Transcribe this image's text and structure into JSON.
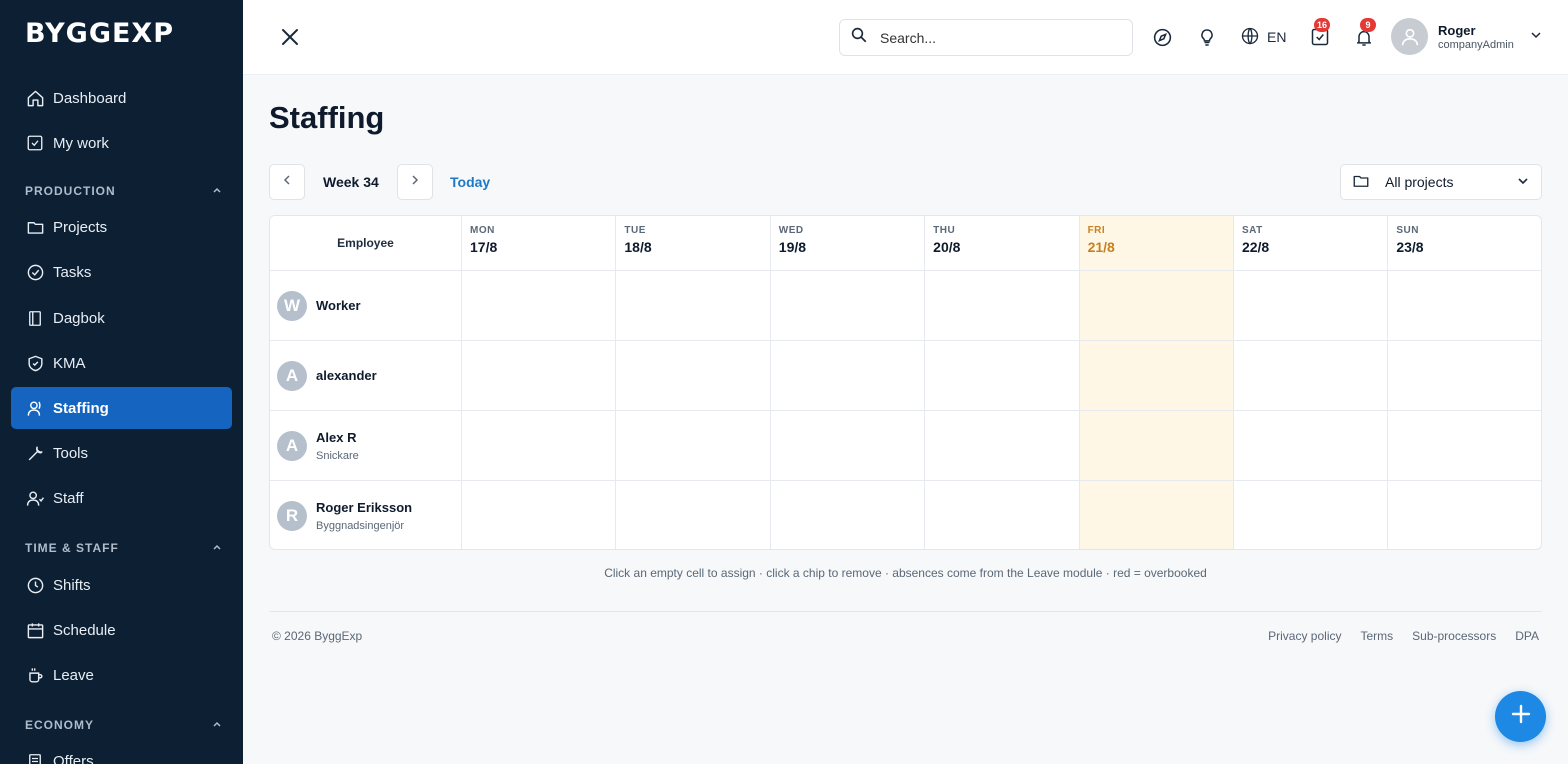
{
  "brand": {
    "logo": "BYGGEXP"
  },
  "sidebar": {
    "items": [
      {
        "label": "Dashboard",
        "icon": "home-icon"
      },
      {
        "label": "My work",
        "icon": "checkbox-icon"
      },
      {
        "label": "Projects",
        "icon": "folder-icon"
      },
      {
        "label": "Tasks",
        "icon": "check-circle-icon"
      },
      {
        "label": "Dagbok",
        "icon": "book-icon"
      },
      {
        "label": "KMA",
        "icon": "shield-icon"
      },
      {
        "label": "Staffing",
        "icon": "users-icon",
        "active": true
      },
      {
        "label": "Tools",
        "icon": "wrench-icon"
      },
      {
        "label": "Staff",
        "icon": "user-group-icon"
      },
      {
        "label": "Shifts",
        "icon": "clock-icon"
      },
      {
        "label": "Schedule",
        "icon": "calendar-icon"
      },
      {
        "label": "Leave",
        "icon": "coffee-icon"
      },
      {
        "label": "Offers",
        "icon": "document-icon"
      }
    ],
    "sections": [
      "PRODUCTION",
      "TIME & STAFF",
      "ECONOMY"
    ]
  },
  "topbar": {
    "search_placeholder": "Search...",
    "lang": "EN",
    "tasks_badge": "16",
    "notifications_badge": "9",
    "user_name": "Roger",
    "user_role": "companyAdmin"
  },
  "page": {
    "title": "Staffing",
    "week_label": "Week 34",
    "today_label": "Today",
    "project_filter": "All projects"
  },
  "grid": {
    "employee_header": "Employee",
    "days": [
      {
        "name": "MON",
        "date": "17/8"
      },
      {
        "name": "TUE",
        "date": "18/8"
      },
      {
        "name": "WED",
        "date": "19/8"
      },
      {
        "name": "THU",
        "date": "20/8"
      },
      {
        "name": "FRI",
        "date": "21/8",
        "today": true
      },
      {
        "name": "SAT",
        "date": "22/8"
      },
      {
        "name": "SUN",
        "date": "23/8"
      }
    ],
    "employees": [
      {
        "initial": "W",
        "name": "Worker",
        "title": ""
      },
      {
        "initial": "A",
        "name": "alexander",
        "title": ""
      },
      {
        "initial": "A",
        "name": "Alex R",
        "title": "Snickare"
      },
      {
        "initial": "R",
        "name": "Roger Eriksson",
        "title": "Byggnadsingenjör"
      }
    ]
  },
  "hint": "Click an empty cell to assign · click a chip to remove · absences come from the Leave module · red = overbooked",
  "footer": {
    "copyright": "© 2026 ByggExp",
    "links": [
      "Privacy policy",
      "Terms",
      "Sub-processors",
      "DPA"
    ]
  },
  "colors": {
    "sidebar_bg": "#0d1f33",
    "accent": "#1565c0",
    "today_bg": "#fff7e6",
    "today_text": "#c8801f",
    "badge": "#e53935"
  }
}
